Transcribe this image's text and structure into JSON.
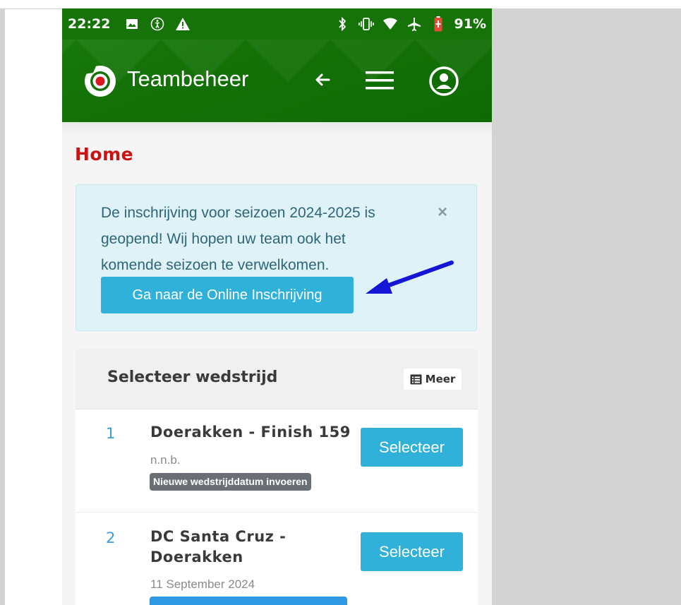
{
  "status_bar": {
    "time": "22:22",
    "left_icons": [
      "image-icon",
      "accessibility-icon",
      "warning-icon"
    ],
    "right_icons": [
      "bluetooth-icon",
      "vibrate-icon",
      "wifi-icon",
      "airplane-icon",
      "battery-icon"
    ],
    "battery": "91%"
  },
  "app_bar": {
    "brand": "Teambeheer",
    "color": "#157307"
  },
  "page": {
    "title": "Home",
    "title_color": "#c81414"
  },
  "alert": {
    "text": "De inschrijving voor seizoen 2024-2025 is geopend! Wij hopen uw team ook het komende seizoen te verwelkomen.",
    "close": "×",
    "button": "Ga naar de Online Inschrijving"
  },
  "matches_card": {
    "title": "Selecteer wedstrijd",
    "more_label": "Meer",
    "matches": [
      {
        "number": "1",
        "teams": "Doerakken - Finish 159",
        "date": "n.n.b.",
        "badge": "Nieuwe wedstrijddatum invoeren",
        "button": "Selecteer"
      },
      {
        "number": "2",
        "teams": "DC Santa Cruz - Doerakken",
        "date": "11 September 2024",
        "badge": "",
        "button": "Selecteer"
      }
    ]
  }
}
